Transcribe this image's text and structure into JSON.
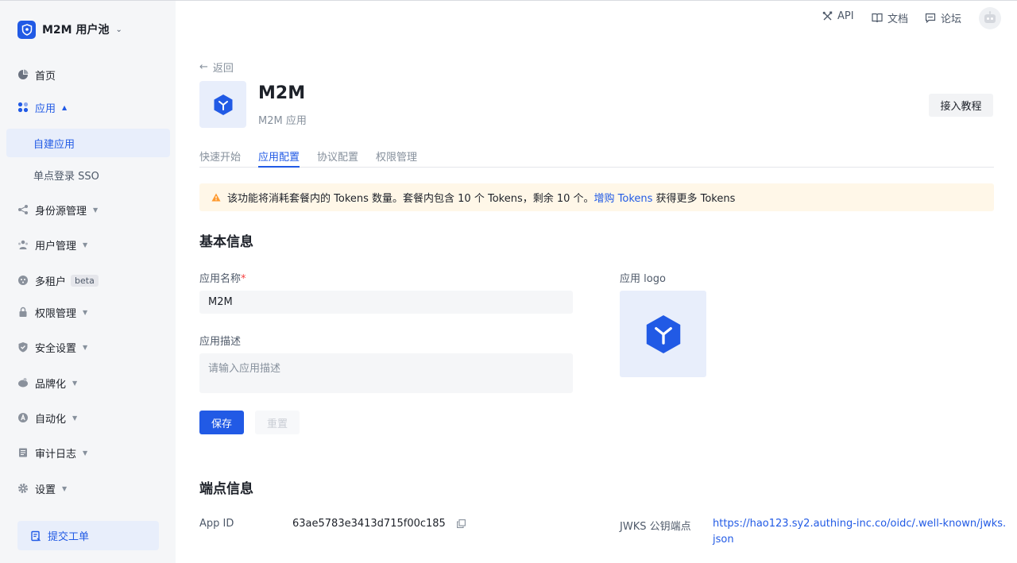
{
  "sidebar": {
    "pool_name": "M2M 用户池",
    "pool_icon": "shield-logo-icon",
    "items": [
      {
        "label": "首页",
        "icon": "pie-chart-icon"
      },
      {
        "label": "应用",
        "icon": "apps-icon"
      },
      {
        "label": "自建应用"
      },
      {
        "label": "单点登录 SSO"
      },
      {
        "label": "身份源管理",
        "icon": "share-icon"
      },
      {
        "label": "用户管理",
        "icon": "users-icon"
      },
      {
        "label": "多租户",
        "icon": "tenant-icon",
        "badge": "beta"
      },
      {
        "label": "权限管理",
        "icon": "lock-icon"
      },
      {
        "label": "安全设置",
        "icon": "shield-icon"
      },
      {
        "label": "品牌化",
        "icon": "brand-icon"
      },
      {
        "label": "自动化",
        "icon": "automation-icon"
      },
      {
        "label": "审计日志",
        "icon": "log-icon"
      },
      {
        "label": "设置",
        "icon": "gear-icon"
      }
    ],
    "ticket_label": "提交工单"
  },
  "topbar": {
    "api_label": "API",
    "docs_label": "文档",
    "forum_label": "论坛"
  },
  "main": {
    "back_label": "返回",
    "app_title": "M2M",
    "app_subtitle": "M2M 应用",
    "tutorial_label": "接入教程",
    "tabs": [
      {
        "label": "快速开始"
      },
      {
        "label": "应用配置"
      },
      {
        "label": "协议配置"
      },
      {
        "label": "权限管理"
      }
    ],
    "active_tab": "应用配置",
    "notice": {
      "text_before": "该功能将消耗套餐内的 Tokens 数量。套餐内包含 10 个 Tokens，剩余 10 个。",
      "link": "增购 Tokens",
      "text_after": "获得更多 Tokens"
    },
    "basic_info": {
      "title": "基本信息",
      "name_label": "应用名称",
      "required_mark": "*",
      "name_value": "M2M",
      "desc_label": "应用描述",
      "desc_placeholder": "请输入应用描述",
      "logo_label": "应用 logo",
      "save_label": "保存",
      "reset_label": "重置"
    },
    "endpoints": {
      "title": "端点信息",
      "app_id_label": "App ID",
      "app_id_value": "63ae5783e3413d715f00c185",
      "jwks_label": "JWKS 公钥端点",
      "jwks_value_line1": "https://hao123.sy2.authing-inc.co/oidc/.well-known/jwks.",
      "jwks_value_line2": "json"
    }
  },
  "colors": {
    "accent": "#215ae5",
    "notice_bg": "#fff7e8",
    "warning": "#ff9a2e",
    "sidebar_bg": "#f5f6f8"
  }
}
